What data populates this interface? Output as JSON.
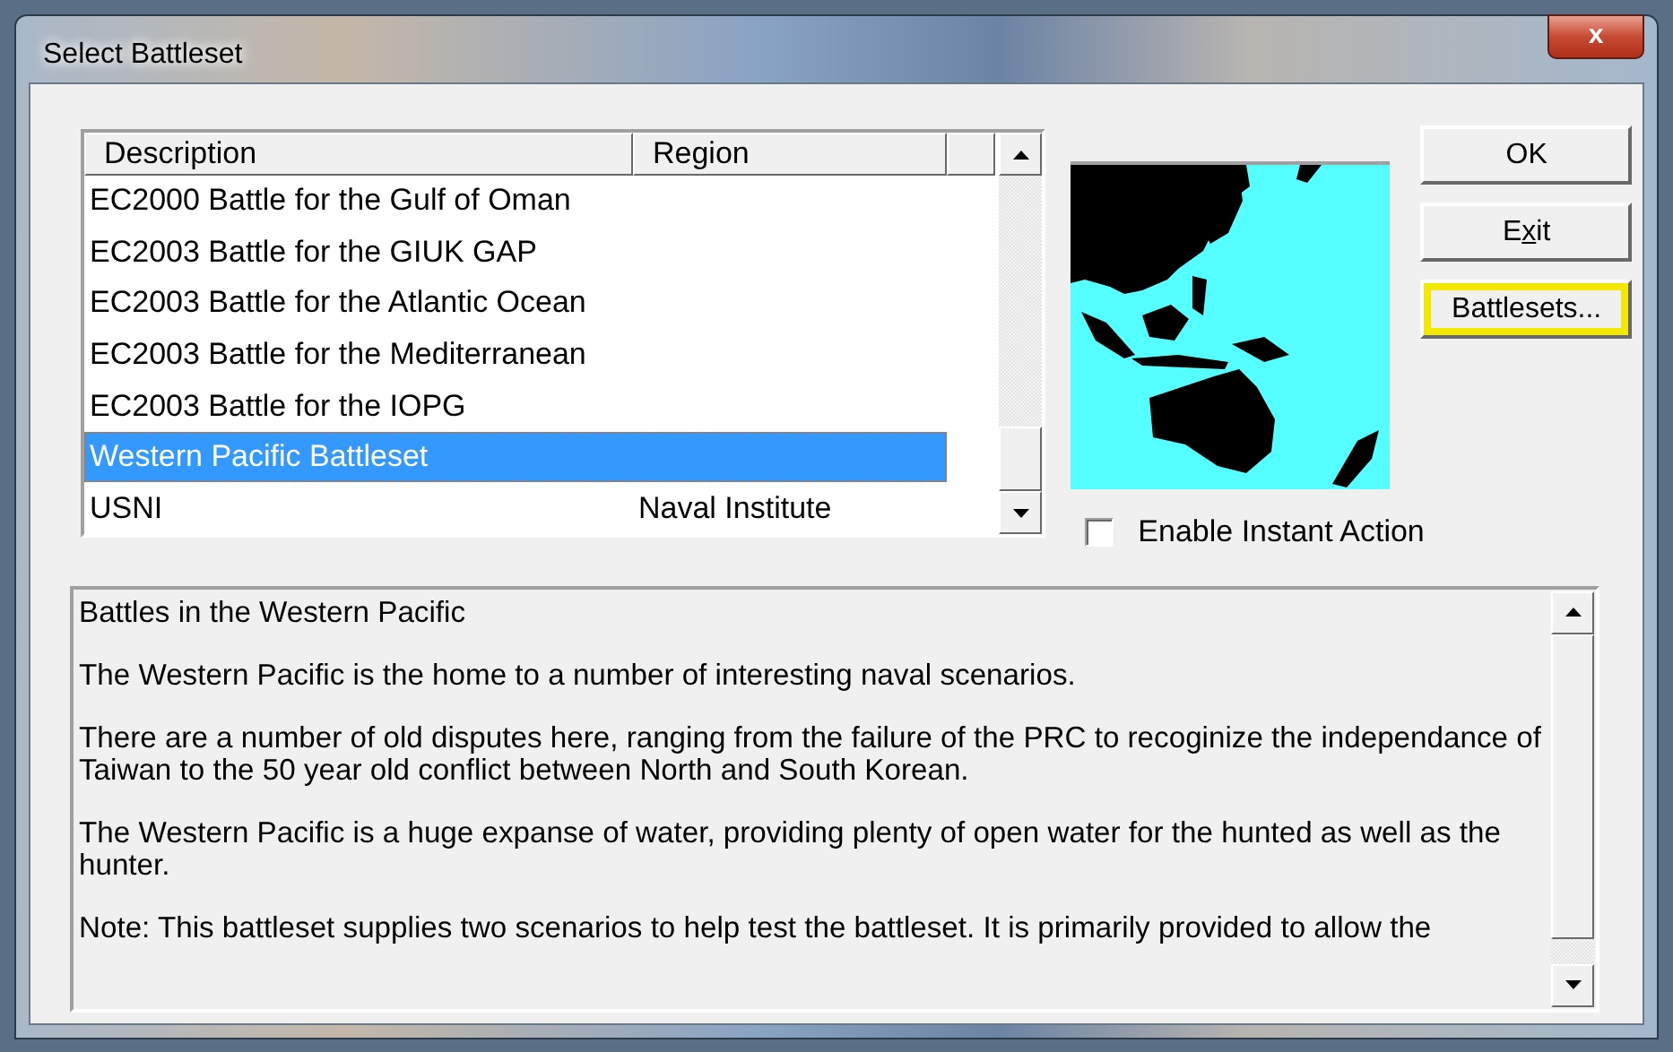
{
  "window": {
    "title": "Select Battleset",
    "close_glyph": "x"
  },
  "battleset_list": {
    "columns": [
      "Description",
      "Region"
    ],
    "rows": [
      {
        "description": "EC2000 Battle for the Gulf of Oman",
        "selected": false
      },
      {
        "description": "EC2003 Battle for the GIUK GAP",
        "selected": false
      },
      {
        "description": "EC2003 Battle for the Atlantic Ocean",
        "selected": false
      },
      {
        "description": "EC2003 Battle for the Mediterranean",
        "selected": false
      },
      {
        "description": "EC2003 Battle for the IOPG",
        "selected": false
      },
      {
        "description": "Western Pacific Battleset",
        "selected": true
      },
      {
        "description": "USNI",
        "region": "Naval Institute",
        "selected": false
      }
    ]
  },
  "instant_action": {
    "label": "Enable Instant Action",
    "checked": false
  },
  "buttons": [
    {
      "label": "OK",
      "highlighted": false
    },
    {
      "label_parts": [
        {
          "text": "E",
          "underlined": false
        },
        {
          "text": "x",
          "underlined": true
        },
        {
          "text": "it",
          "underlined": false
        }
      ],
      "highlighted": false
    },
    {
      "label": "Battlesets...",
      "highlighted": true
    }
  ],
  "description": {
    "paragraphs": [
      "Battles in the Western Pacific",
      "The Western Pacific is the home to a number of interesting naval scenarios.",
      "There are a number of old disputes here, ranging from the failure of the PRC to recoginize the independance of Taiwan to the 50 year old conflict between North and South Korean.",
      "The Western Pacific is a huge expanse of water, providing plenty of open water for the hunted as well as the hunter.",
      "Note: This battleset supplies two scenarios to help test the battleset. It is  primarily provided to allow the"
    ]
  }
}
